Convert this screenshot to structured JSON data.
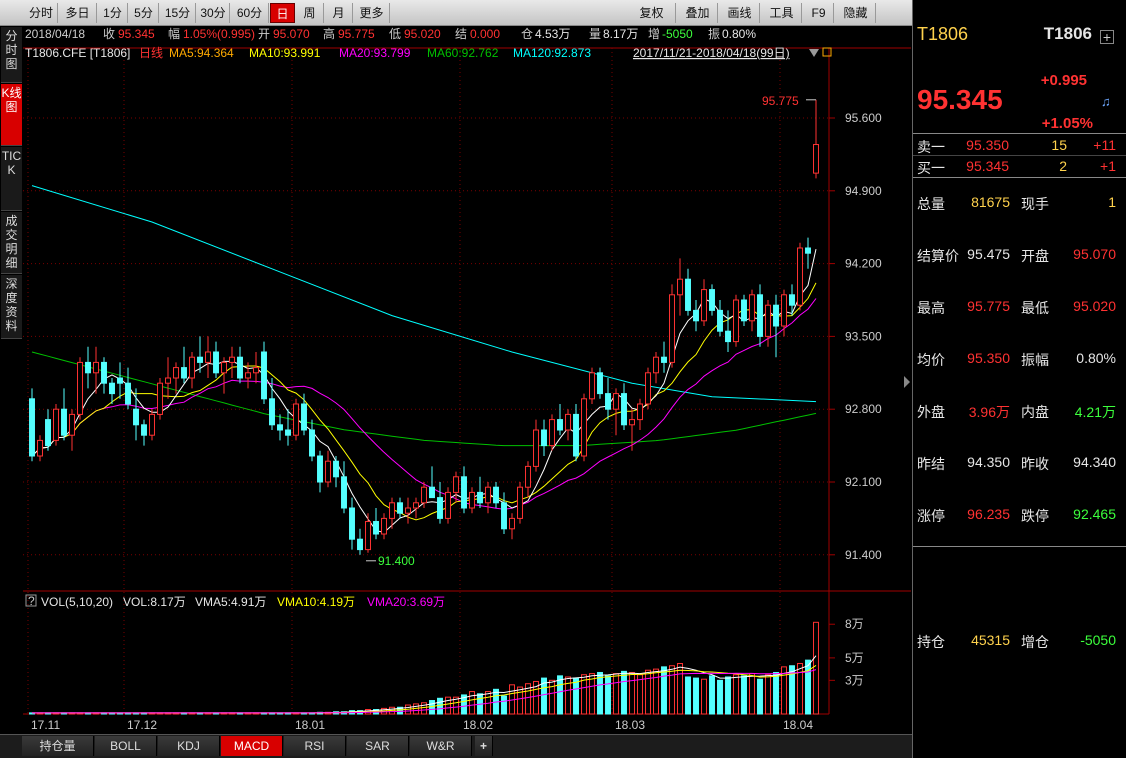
{
  "toolbar": {
    "periods": [
      "分时",
      "多日",
      "1分",
      "5分",
      "15分",
      "30分",
      "60分",
      "日",
      "周",
      "月",
      "更多"
    ],
    "active_period": "日",
    "tools": [
      "复权",
      "叠加",
      "画线",
      "工具",
      "F9",
      "隐藏"
    ]
  },
  "side_tabs": [
    "分时图",
    "K线图",
    "TICK",
    "成交明细",
    "深度资料"
  ],
  "active_side_tab": "K线图",
  "quote_bar": {
    "date": "2018/04/18",
    "close_label": "收",
    "close": "95.345",
    "change_label": "幅",
    "change": "1.05%(0.995)",
    "open_label": "开",
    "open": "95.070",
    "high_label": "高",
    "high": "95.775",
    "low_label": "低",
    "low": "95.020",
    "settle_label": "结",
    "settle": "0.000",
    "oi_label": "仓",
    "oi": "4.53万",
    "vol_label": "量",
    "vol": "8.17万",
    "inc_label": "增",
    "inc": "-5050",
    "amp_label": "振",
    "amp": "0.80%"
  },
  "indicator_bar": {
    "symbol": "T1806.CFE [T1806]",
    "period": "日线",
    "ma5": "MA5:94.364",
    "ma10": "MA10:93.991",
    "ma20": "MA20:93.799",
    "ma60": "MA60:92.762",
    "ma120": "MA120:92.873",
    "range": "2017/11/21-2018/04/18(99日)"
  },
  "vol_bar": {
    "title": "VOL(5,10,20)",
    "vol": "VOL:8.17万",
    "vma5": "VMA5:4.91万",
    "vma10": "VMA10:4.19万",
    "vma20": "VMA20:3.69万"
  },
  "annotations": {
    "high_mark": "95.775",
    "low_mark": "91.400"
  },
  "colors": {
    "up": "#ff3232",
    "down": "#54ffff",
    "ma5": "#ffffff",
    "ma10": "#ffff00",
    "ma20": "#ff00ff",
    "ma60": "#00c000",
    "ma120": "#00ffff",
    "accent": "#d80000"
  },
  "chart_data": {
    "type": "candlestick",
    "price_axis": {
      "ylim": [
        91.1,
        96.1
      ],
      "ticks": [
        "95.600",
        "94.900",
        "94.200",
        "93.500",
        "92.800",
        "92.100",
        "91.400"
      ]
    },
    "volume_axis": {
      "ylim": [
        0,
        9
      ],
      "ticks": [
        "8万",
        "5万",
        "3万"
      ]
    },
    "x_ticks": [
      "17.11",
      "17.12",
      "18.01",
      "18.02",
      "18.03",
      "18.04"
    ],
    "candles": [
      {
        "o": 92.9,
        "h": 93.0,
        "l": 92.3,
        "c": 92.35
      },
      {
        "o": 92.35,
        "h": 92.55,
        "l": 92.3,
        "c": 92.5
      },
      {
        "o": 92.7,
        "h": 92.8,
        "l": 92.4,
        "c": 92.45
      },
      {
        "o": 92.5,
        "h": 92.85,
        "l": 92.45,
        "c": 92.8
      },
      {
        "o": 92.8,
        "h": 93.0,
        "l": 92.5,
        "c": 92.55
      },
      {
        "o": 92.55,
        "h": 92.8,
        "l": 92.4,
        "c": 92.75
      },
      {
        "o": 92.75,
        "h": 93.3,
        "l": 92.7,
        "c": 93.25
      },
      {
        "o": 93.25,
        "h": 93.4,
        "l": 93.0,
        "c": 93.15
      },
      {
        "o": 93.15,
        "h": 93.4,
        "l": 92.95,
        "c": 93.25
      },
      {
        "o": 93.25,
        "h": 93.3,
        "l": 92.95,
        "c": 93.05
      },
      {
        "o": 93.05,
        "h": 93.1,
        "l": 92.85,
        "c": 92.95
      },
      {
        "o": 93.1,
        "h": 93.25,
        "l": 92.9,
        "c": 93.05
      },
      {
        "o": 93.05,
        "h": 93.2,
        "l": 92.8,
        "c": 92.85
      },
      {
        "o": 92.8,
        "h": 93.0,
        "l": 92.5,
        "c": 92.65
      },
      {
        "o": 92.65,
        "h": 92.7,
        "l": 92.45,
        "c": 92.55
      },
      {
        "o": 92.55,
        "h": 92.8,
        "l": 92.5,
        "c": 92.75
      },
      {
        "o": 92.75,
        "h": 93.1,
        "l": 92.7,
        "c": 93.05
      },
      {
        "o": 93.05,
        "h": 93.3,
        "l": 92.9,
        "c": 93.1
      },
      {
        "o": 93.1,
        "h": 93.25,
        "l": 92.95,
        "c": 93.2
      },
      {
        "o": 93.2,
        "h": 93.4,
        "l": 93.05,
        "c": 93.1
      },
      {
        "o": 93.1,
        "h": 93.35,
        "l": 93.0,
        "c": 93.3
      },
      {
        "o": 93.3,
        "h": 93.5,
        "l": 93.15,
        "c": 93.25
      },
      {
        "o": 93.25,
        "h": 93.5,
        "l": 93.1,
        "c": 93.35
      },
      {
        "o": 93.35,
        "h": 93.45,
        "l": 93.1,
        "c": 93.15
      },
      {
        "o": 93.15,
        "h": 93.3,
        "l": 92.95,
        "c": 93.25
      },
      {
        "o": 93.25,
        "h": 93.4,
        "l": 93.1,
        "c": 93.3
      },
      {
        "o": 93.3,
        "h": 93.4,
        "l": 93.05,
        "c": 93.1
      },
      {
        "o": 93.1,
        "h": 93.25,
        "l": 93.0,
        "c": 93.15
      },
      {
        "o": 93.15,
        "h": 93.35,
        "l": 93.05,
        "c": 93.2
      },
      {
        "o": 93.35,
        "h": 93.45,
        "l": 92.85,
        "c": 92.9
      },
      {
        "o": 92.9,
        "h": 93.1,
        "l": 92.6,
        "c": 92.65
      },
      {
        "o": 92.65,
        "h": 92.75,
        "l": 92.5,
        "c": 92.6
      },
      {
        "o": 92.6,
        "h": 92.8,
        "l": 92.45,
        "c": 92.55
      },
      {
        "o": 92.55,
        "h": 92.9,
        "l": 92.5,
        "c": 92.85
      },
      {
        "o": 92.85,
        "h": 92.95,
        "l": 92.55,
        "c": 92.6
      },
      {
        "o": 92.6,
        "h": 92.7,
        "l": 92.3,
        "c": 92.35
      },
      {
        "o": 92.35,
        "h": 92.4,
        "l": 92.0,
        "c": 92.1
      },
      {
        "o": 92.1,
        "h": 92.4,
        "l": 92.05,
        "c": 92.3
      },
      {
        "o": 92.3,
        "h": 92.35,
        "l": 92.05,
        "c": 92.15
      },
      {
        "o": 92.15,
        "h": 92.3,
        "l": 91.8,
        "c": 91.85
      },
      {
        "o": 91.85,
        "h": 91.95,
        "l": 91.45,
        "c": 91.55
      },
      {
        "o": 91.55,
        "h": 91.65,
        "l": 91.4,
        "c": 91.45
      },
      {
        "o": 91.45,
        "h": 91.8,
        "l": 91.42,
        "c": 91.72
      },
      {
        "o": 91.72,
        "h": 91.85,
        "l": 91.55,
        "c": 91.6
      },
      {
        "o": 91.6,
        "h": 91.8,
        "l": 91.55,
        "c": 91.75
      },
      {
        "o": 91.75,
        "h": 91.95,
        "l": 91.65,
        "c": 91.9
      },
      {
        "o": 91.9,
        "h": 91.95,
        "l": 91.75,
        "c": 91.8
      },
      {
        "o": 91.8,
        "h": 91.95,
        "l": 91.7,
        "c": 91.85
      },
      {
        "o": 91.85,
        "h": 91.95,
        "l": 91.75,
        "c": 91.9
      },
      {
        "o": 91.9,
        "h": 92.1,
        "l": 91.85,
        "c": 92.05
      },
      {
        "o": 92.05,
        "h": 92.25,
        "l": 91.95,
        "c": 91.95
      },
      {
        "o": 91.95,
        "h": 92.1,
        "l": 91.7,
        "c": 91.75
      },
      {
        "o": 91.75,
        "h": 92.05,
        "l": 91.7,
        "c": 92.0
      },
      {
        "o": 92.0,
        "h": 92.2,
        "l": 91.9,
        "c": 92.15
      },
      {
        "o": 92.15,
        "h": 92.25,
        "l": 91.8,
        "c": 91.85
      },
      {
        "o": 91.85,
        "h": 92.05,
        "l": 91.8,
        "c": 92.0
      },
      {
        "o": 92.0,
        "h": 92.15,
        "l": 91.85,
        "c": 91.9
      },
      {
        "o": 91.9,
        "h": 92.1,
        "l": 91.8,
        "c": 92.05
      },
      {
        "o": 92.05,
        "h": 92.1,
        "l": 91.85,
        "c": 91.9
      },
      {
        "o": 91.9,
        "h": 92.0,
        "l": 91.6,
        "c": 91.65
      },
      {
        "o": 91.65,
        "h": 91.8,
        "l": 91.55,
        "c": 91.75
      },
      {
        "o": 91.75,
        "h": 92.1,
        "l": 91.7,
        "c": 92.05
      },
      {
        "o": 92.05,
        "h": 92.3,
        "l": 91.95,
        "c": 92.25
      },
      {
        "o": 92.25,
        "h": 92.7,
        "l": 92.2,
        "c": 92.6
      },
      {
        "o": 92.6,
        "h": 92.7,
        "l": 92.35,
        "c": 92.45
      },
      {
        "o": 92.45,
        "h": 92.75,
        "l": 92.4,
        "c": 92.7
      },
      {
        "o": 92.7,
        "h": 92.85,
        "l": 92.55,
        "c": 92.6
      },
      {
        "o": 92.6,
        "h": 92.8,
        "l": 92.5,
        "c": 92.75
      },
      {
        "o": 92.75,
        "h": 92.85,
        "l": 92.3,
        "c": 92.35
      },
      {
        "o": 92.35,
        "h": 92.95,
        "l": 92.3,
        "c": 92.9
      },
      {
        "o": 92.9,
        "h": 93.2,
        "l": 92.85,
        "c": 93.15
      },
      {
        "o": 93.15,
        "h": 93.2,
        "l": 92.9,
        "c": 92.95
      },
      {
        "o": 92.95,
        "h": 93.1,
        "l": 92.7,
        "c": 92.8
      },
      {
        "o": 92.8,
        "h": 93.0,
        "l": 92.55,
        "c": 92.95
      },
      {
        "o": 92.95,
        "h": 93.05,
        "l": 92.6,
        "c": 92.65
      },
      {
        "o": 92.65,
        "h": 92.8,
        "l": 92.4,
        "c": 92.7
      },
      {
        "o": 92.7,
        "h": 92.9,
        "l": 92.6,
        "c": 92.85
      },
      {
        "o": 92.85,
        "h": 93.2,
        "l": 92.8,
        "c": 93.15
      },
      {
        "o": 93.15,
        "h": 93.35,
        "l": 93.05,
        "c": 93.3
      },
      {
        "o": 93.3,
        "h": 93.45,
        "l": 93.15,
        "c": 93.25
      },
      {
        "o": 93.25,
        "h": 94.0,
        "l": 93.2,
        "c": 93.9
      },
      {
        "o": 93.9,
        "h": 94.25,
        "l": 93.7,
        "c": 94.05
      },
      {
        "o": 94.05,
        "h": 94.15,
        "l": 93.7,
        "c": 93.75
      },
      {
        "o": 93.75,
        "h": 93.85,
        "l": 93.55,
        "c": 93.65
      },
      {
        "o": 93.65,
        "h": 94.05,
        "l": 93.6,
        "c": 93.95
      },
      {
        "o": 93.95,
        "h": 94.0,
        "l": 93.7,
        "c": 93.75
      },
      {
        "o": 93.75,
        "h": 93.85,
        "l": 93.5,
        "c": 93.55
      },
      {
        "o": 93.55,
        "h": 93.75,
        "l": 93.35,
        "c": 93.45
      },
      {
        "o": 93.45,
        "h": 93.9,
        "l": 93.4,
        "c": 93.85
      },
      {
        "o": 93.85,
        "h": 93.9,
        "l": 93.6,
        "c": 93.65
      },
      {
        "o": 93.65,
        "h": 93.95,
        "l": 93.55,
        "c": 93.9
      },
      {
        "o": 93.9,
        "h": 94.0,
        "l": 93.4,
        "c": 93.5
      },
      {
        "o": 93.5,
        "h": 93.85,
        "l": 93.4,
        "c": 93.8
      },
      {
        "o": 93.8,
        "h": 93.9,
        "l": 93.3,
        "c": 93.6
      },
      {
        "o": 93.6,
        "h": 93.95,
        "l": 93.5,
        "c": 93.9
      },
      {
        "o": 93.9,
        "h": 94.0,
        "l": 93.7,
        "c": 93.8
      },
      {
        "o": 93.8,
        "h": 94.4,
        "l": 93.75,
        "c": 94.35
      },
      {
        "o": 94.35,
        "h": 94.45,
        "l": 94.15,
        "c": 94.3
      },
      {
        "o": 95.07,
        "h": 95.775,
        "l": 95.02,
        "c": 95.345
      }
    ],
    "volume": [
      0.1,
      0.1,
      0.1,
      0.1,
      0.1,
      0.1,
      0.1,
      0.1,
      0.1,
      0.1,
      0.1,
      0.1,
      0.1,
      0.1,
      0.1,
      0.1,
      0.1,
      0.1,
      0.1,
      0.1,
      0.1,
      0.1,
      0.1,
      0.1,
      0.1,
      0.1,
      0.1,
      0.1,
      0.1,
      0.1,
      0.1,
      0.1,
      0.1,
      0.1,
      0.1,
      0.1,
      0.15,
      0.15,
      0.2,
      0.2,
      0.3,
      0.3,
      0.4,
      0.4,
      0.5,
      0.6,
      0.6,
      0.8,
      0.9,
      1.0,
      1.2,
      1.4,
      1.5,
      1.5,
      1.7,
      2.0,
      1.8,
      2.0,
      2.2,
      1.6,
      2.6,
      2.4,
      2.7,
      2.9,
      3.2,
      3.0,
      3.4,
      3.3,
      3.2,
      3.5,
      3.6,
      3.7,
      3.4,
      3.6,
      3.8,
      3.7,
      3.5,
      3.9,
      4.0,
      4.2,
      4.3,
      4.5,
      3.3,
      3.2,
      3.1,
      3.4,
      3.0,
      3.3,
      3.5,
      3.4,
      3.6,
      3.1,
      3.5,
      3.7,
      4.2,
      4.3,
      4.5,
      4.8,
      8.17
    ],
    "ma120": [
      [
        0,
        94.95
      ],
      [
        15,
        94.6
      ],
      [
        30,
        94.15
      ],
      [
        45,
        93.7
      ],
      [
        60,
        93.35
      ],
      [
        75,
        93.05
      ],
      [
        85,
        92.92
      ],
      [
        98,
        92.873
      ]
    ]
  },
  "right_panel": {
    "symbol": "T1806",
    "code": "T1806",
    "price": "95.345",
    "change": "+0.995",
    "change_pct": "+1.05%",
    "ask_label": "卖一",
    "ask_price": "95.350",
    "ask_vol": "15",
    "ask_delta": "+11",
    "bid_label": "买一",
    "bid_price": "95.345",
    "bid_vol": "2",
    "bid_delta": "+1",
    "rows": [
      {
        "l1": "总量",
        "v1": "81675",
        "l2": "现手",
        "v2": "1",
        "c1": "#ffd24d",
        "c2": "#ffd24d"
      },
      {
        "l1": "结算价",
        "v1": "95.475",
        "l2": "开盘",
        "v2": "95.070",
        "c1": "#e6e6e6",
        "c2": "#ff3232"
      },
      {
        "l1": "最高",
        "v1": "95.775",
        "l2": "最低",
        "v2": "95.020",
        "c1": "#ff3232",
        "c2": "#ff3232"
      },
      {
        "l1": "均价",
        "v1": "95.350",
        "l2": "振幅",
        "v2": "0.80%",
        "c1": "#ff3232",
        "c2": "#e6e6e6"
      },
      {
        "l1": "外盘",
        "v1": "3.96万",
        "l2": "内盘",
        "v2": "4.21万",
        "c1": "#ff3232",
        "c2": "#3cff3c"
      },
      {
        "l1": "昨结",
        "v1": "94.350",
        "l2": "昨收",
        "v2": "94.340",
        "c1": "#e6e6e6",
        "c2": "#e6e6e6"
      },
      {
        "l1": "涨停",
        "v1": "96.235",
        "l2": "跌停",
        "v2": "92.465",
        "c1": "#ff3232",
        "c2": "#3cff3c"
      },
      {
        "l1": "持仓",
        "v1": "45315",
        "l2": "增仓",
        "v2": "-5050",
        "c1": "#ffd24d",
        "c2": "#3cff3c"
      }
    ]
  },
  "bottom_tabs": [
    "持仓量",
    "BOLL",
    "KDJ",
    "MACD",
    "RSI",
    "SAR",
    "W&R"
  ],
  "active_bottom_tab": "MACD"
}
